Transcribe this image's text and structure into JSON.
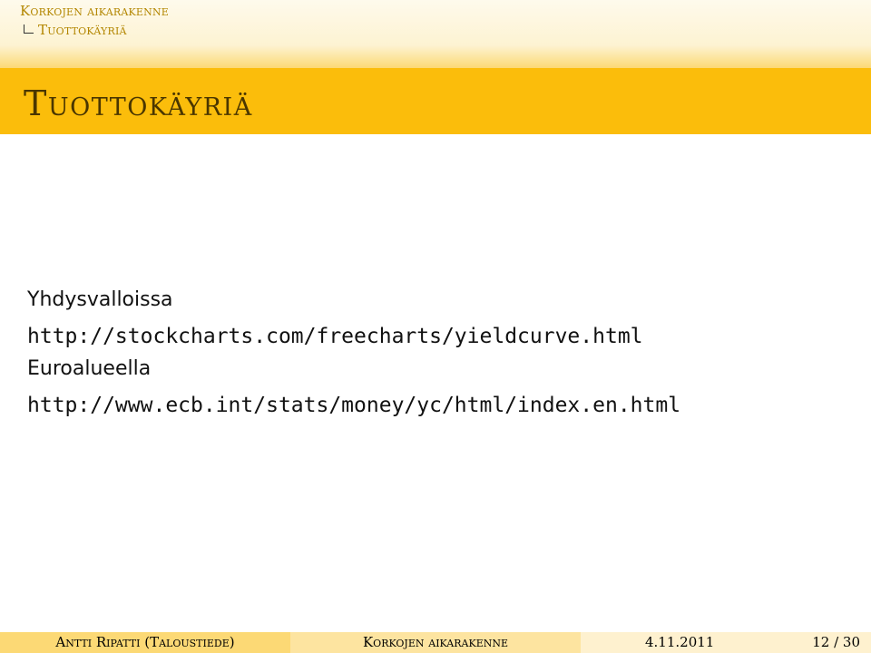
{
  "header": {
    "section": "Korkojen aikarakenne",
    "subsection": "Tuottokäyriä"
  },
  "frame": {
    "title": "Tuottokäyriä"
  },
  "content": {
    "items": [
      {
        "label": "Yhdysvalloissa",
        "url": "http://stockcharts.com/freecharts/yieldcurve.html"
      },
      {
        "label": "Euroalueella",
        "url": "http://www.ecb.int/stats/money/yc/html/index.en.html"
      }
    ]
  },
  "footer": {
    "author": "Antti Ripatti (Taloustiede)",
    "title": "Korkojen aikarakenne",
    "date": "4.11.2011",
    "page": "12 / 30"
  },
  "colors": {
    "title_bar": "#fbbd0b",
    "title_text": "#4a3600",
    "nav_text": "#b38600",
    "footer_author_bg": "#fcd975",
    "footer_title_bg": "#fde4a0",
    "footer_info_bg": "#fef1cf"
  }
}
